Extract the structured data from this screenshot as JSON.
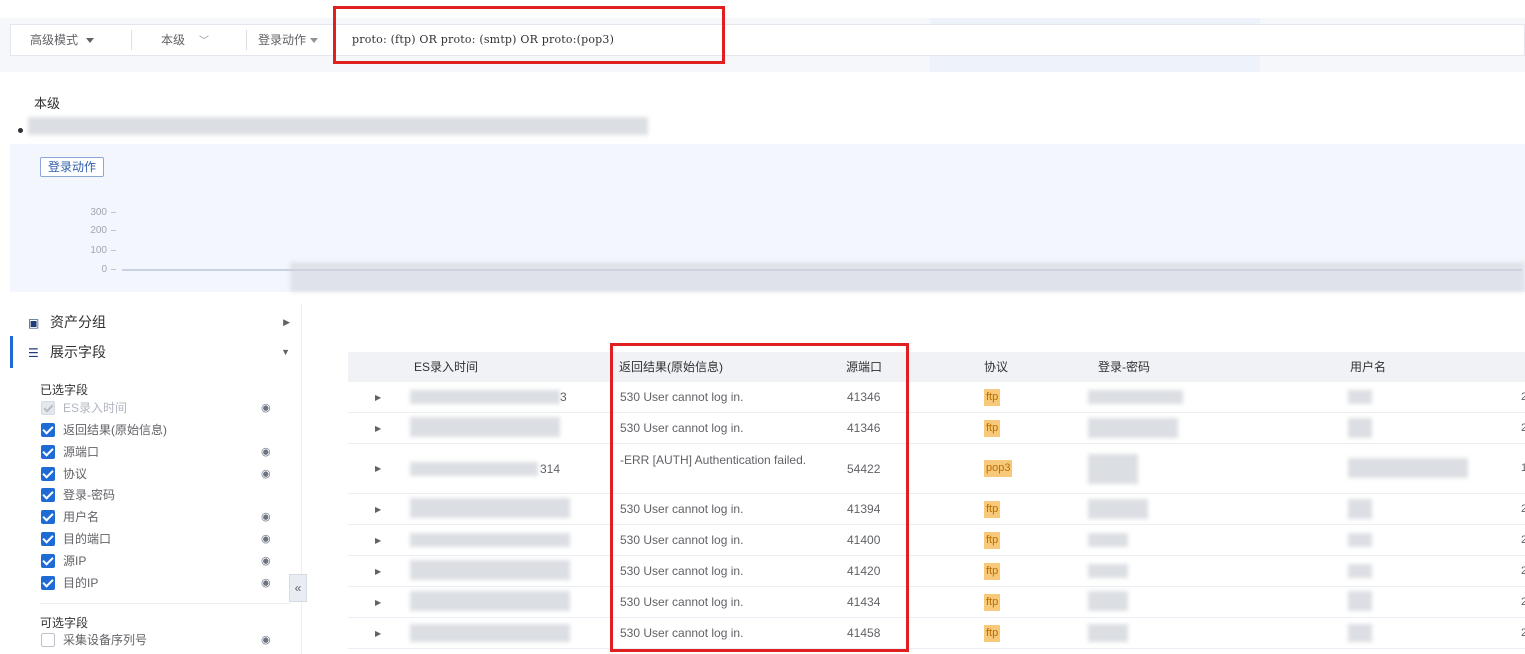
{
  "toolbar": {
    "mode_label": "高级模式",
    "scope_label": "本级",
    "action_label": "登录动作",
    "query": "proto: (ftp) OR proto: (smtp) OR proto:(pop3)"
  },
  "header": {
    "scope_title": "本级"
  },
  "chart_data": {
    "type": "bar",
    "title": "",
    "button_label": "登录动作",
    "y_ticks": [
      "300",
      "200",
      "100",
      "0"
    ],
    "ylim": [
      0,
      300
    ]
  },
  "sidebar": {
    "asset_group": "资产分组",
    "display_fields": "展示字段",
    "selected_title": "已选字段",
    "selected": [
      {
        "label": "ES录入时间",
        "state": "disabled",
        "eye": true
      },
      {
        "label": "返回结果(原始信息)",
        "state": "on",
        "eye": false
      },
      {
        "label": "源端口",
        "state": "on",
        "eye": true
      },
      {
        "label": "协议",
        "state": "on",
        "eye": true
      },
      {
        "label": "登录-密码",
        "state": "on",
        "eye": false
      },
      {
        "label": "用户名",
        "state": "on",
        "eye": true
      },
      {
        "label": "目的端口",
        "state": "on",
        "eye": true
      },
      {
        "label": "源IP",
        "state": "on",
        "eye": true
      },
      {
        "label": "目的IP",
        "state": "on",
        "eye": true
      }
    ],
    "optional_title": "可选字段",
    "optional": [
      {
        "label": "采集设备序列号",
        "state": "off",
        "eye": true
      }
    ]
  },
  "table": {
    "columns": [
      "ES录入时间",
      "返回结果(原始信息)",
      "源端口",
      "协议",
      "登录-密码",
      "用户名"
    ],
    "rows": [
      {
        "time_suffix": "3",
        "result": "530 User cannot log in.",
        "port": "41346",
        "proto": "ftp",
        "edge": "2"
      },
      {
        "time_suffix": "",
        "result": "530 User cannot log in.",
        "port": "41346",
        "proto": "ftp",
        "edge": "2"
      },
      {
        "time_suffix": "314",
        "result": "-ERR [AUTH] Authentication failed.",
        "port": "54422",
        "proto": "pop3",
        "edge": "1"
      },
      {
        "time_suffix": "",
        "result": "530 User cannot log in.",
        "port": "41394",
        "proto": "ftp",
        "edge": "2"
      },
      {
        "time_suffix": "",
        "result": "530 User cannot log in.",
        "port": "41400",
        "proto": "ftp",
        "edge": "2"
      },
      {
        "time_suffix": "",
        "result": "530 User cannot log in.",
        "port": "41420",
        "proto": "ftp",
        "edge": "2"
      },
      {
        "time_suffix": "",
        "result": "530 User cannot log in.",
        "port": "41434",
        "proto": "ftp",
        "edge": "2"
      },
      {
        "time_suffix": "",
        "result": "530 User cannot log in.",
        "port": "41458",
        "proto": "ftp",
        "edge": "2"
      }
    ]
  }
}
